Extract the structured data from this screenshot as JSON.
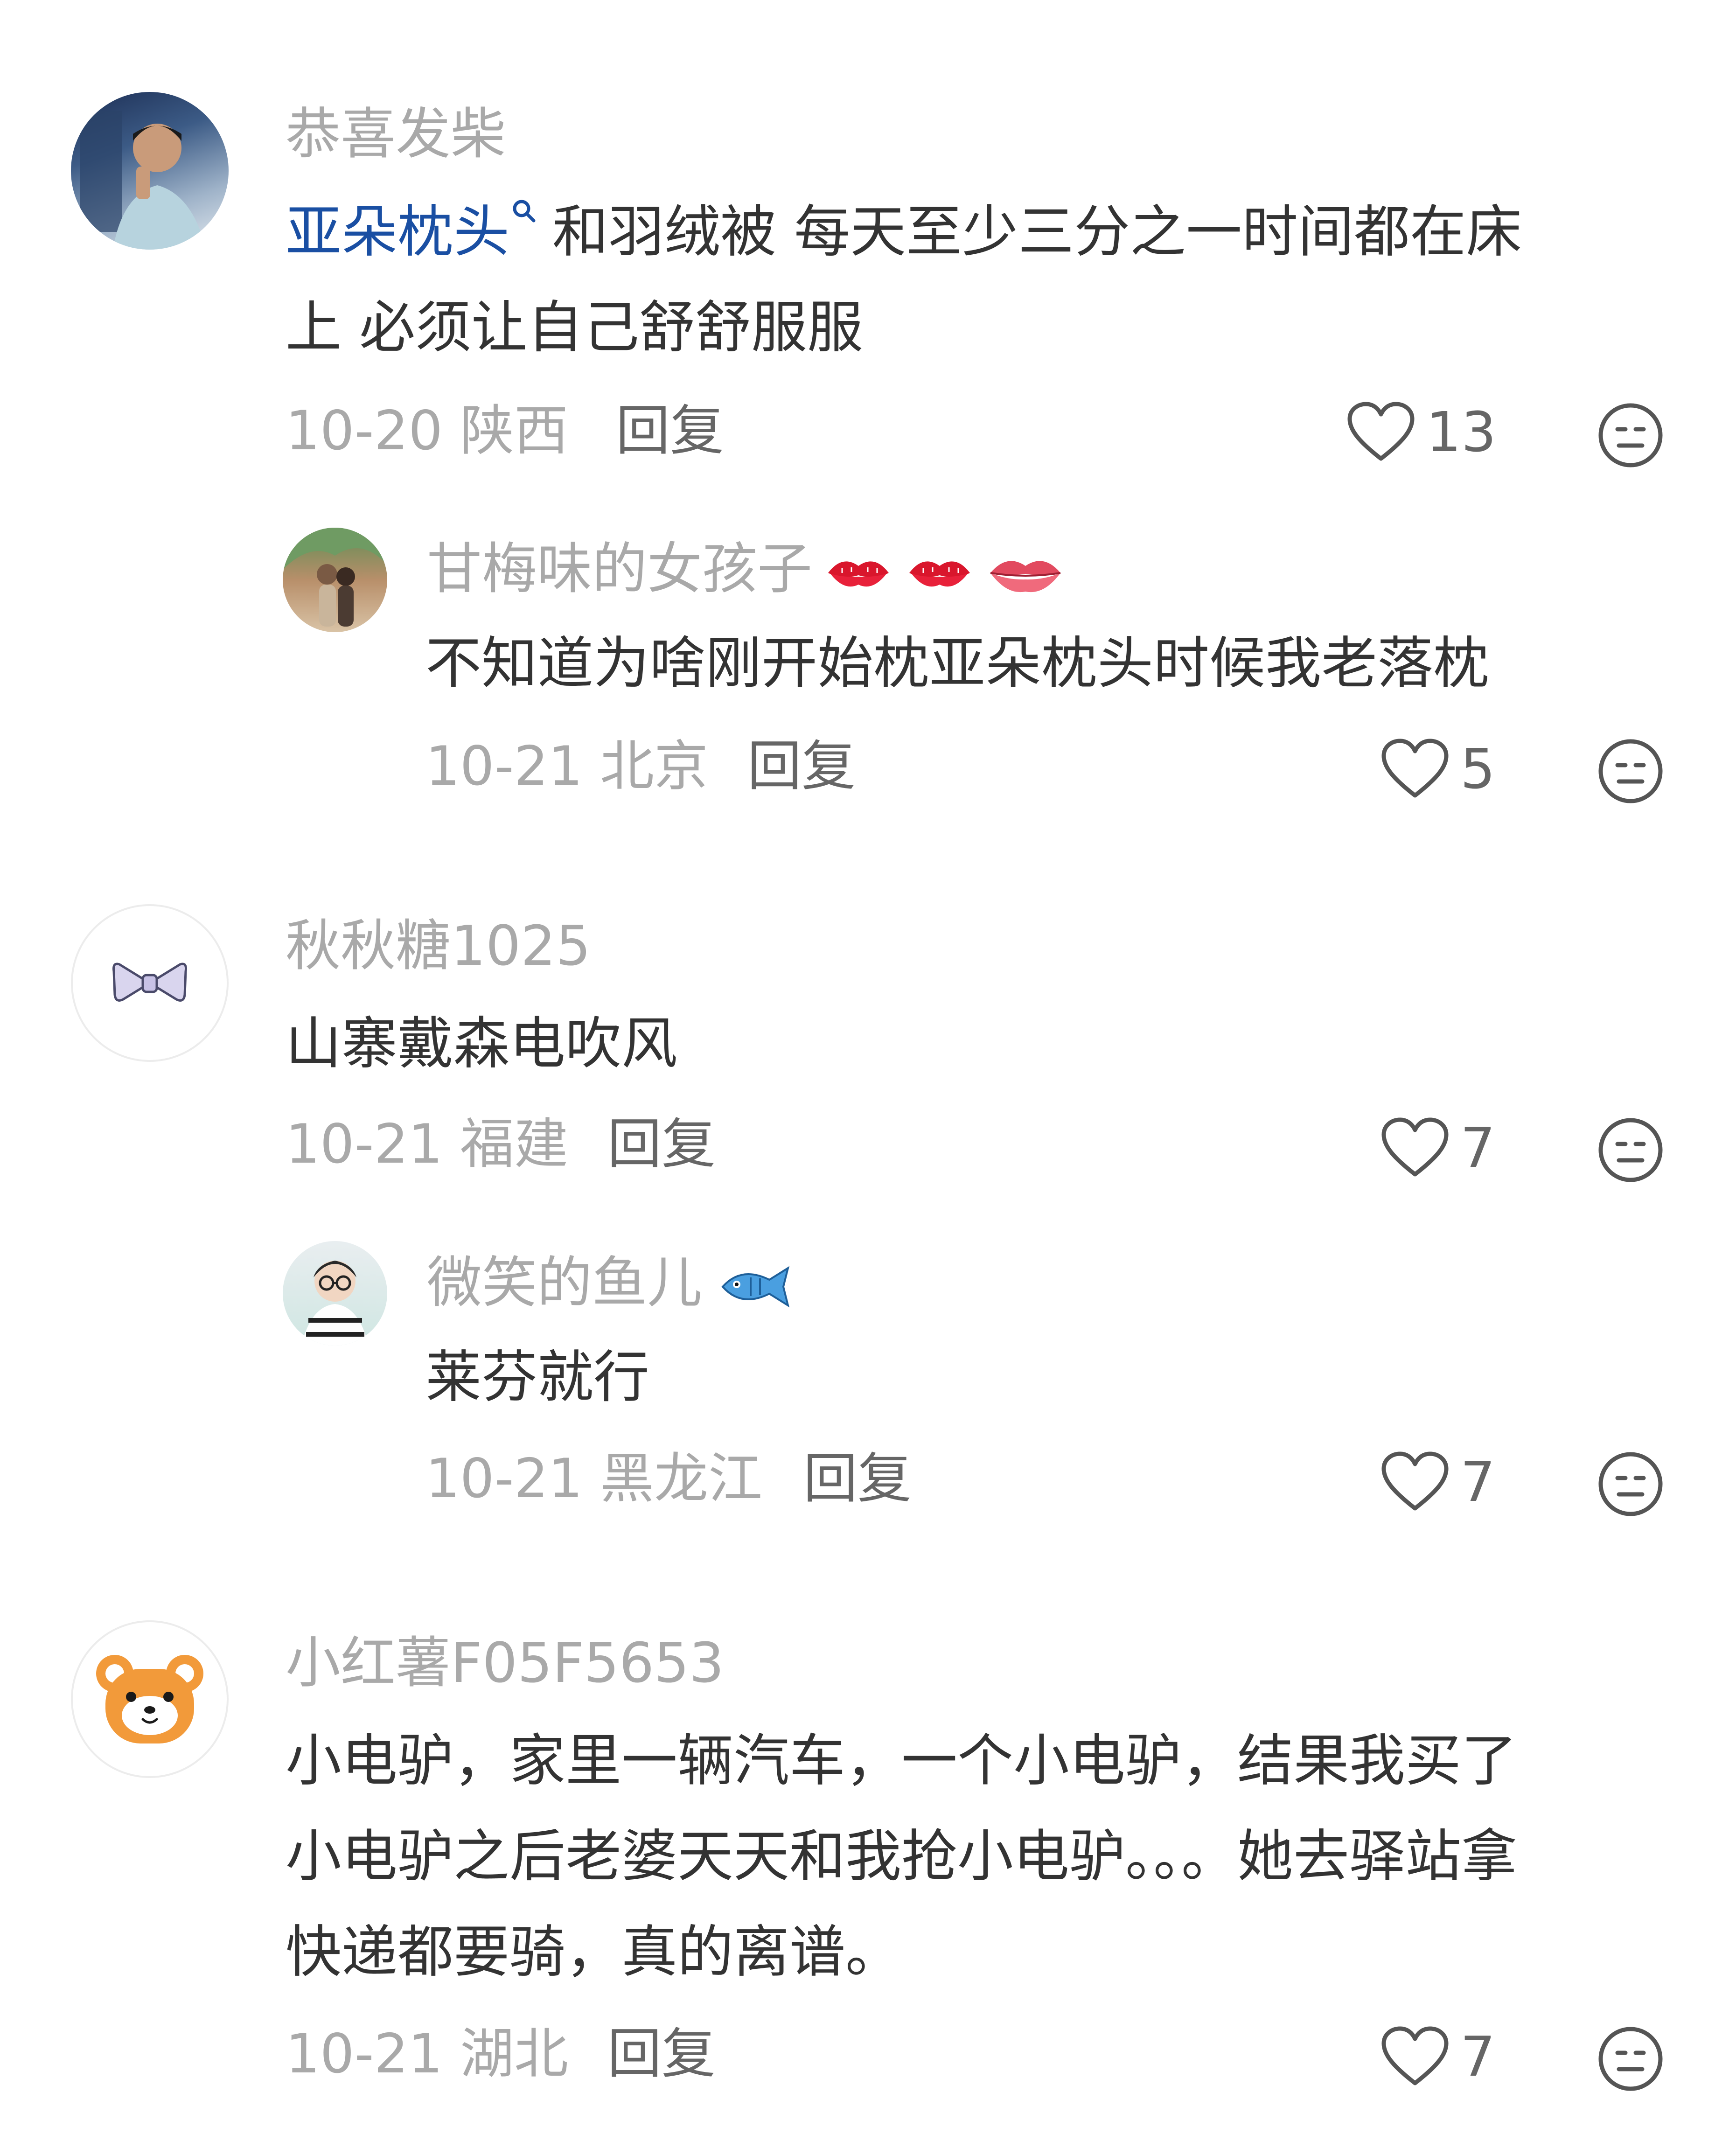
{
  "colors": {
    "username": "#a9a9a9",
    "text": "#333333",
    "mention": "#1a4fa3",
    "meta": "#a9a9a9",
    "reply": "#666666",
    "icon": "#555555"
  },
  "comments": [
    {
      "username": "恭喜发柴",
      "avatar": "man-photo-avatar",
      "mention": "亚朵枕头",
      "mention_icon": "search-icon",
      "text_line1": "和羽绒被 每天至少三分之一时间都在床",
      "text_line2": "上 必须让自己舒舒服服",
      "date_location": "10-20 陕西",
      "reply_label": "回复",
      "likes": "13",
      "react_icon": "emoji-face-icon"
    },
    {
      "username": "甘梅味的女孩子",
      "avatar": "couple-photo-avatar",
      "badge_icons": [
        "kiss-mark-icon",
        "kiss-mark-icon",
        "lips-icon"
      ],
      "text_line1": "不知道为啥刚开始枕亚朵枕头时候我老落枕",
      "date_location": "10-21 北京",
      "reply_label": "回复",
      "likes": "5",
      "react_icon": "emoji-face-icon"
    },
    {
      "username": "秋秋糖1025",
      "avatar": "bow-avatar",
      "text_line1": "山寨戴森电吹风",
      "date_location": "10-21 福建",
      "reply_label": "回复",
      "likes": "7",
      "react_icon": "emoji-face-icon"
    },
    {
      "username": "微笑的鱼儿",
      "avatar": "boy-glasses-avatar",
      "badge_icons": [
        "fish-icon"
      ],
      "text_line1": "莱芬就行",
      "date_location": "10-21 黑龙江",
      "reply_label": "回复",
      "likes": "7",
      "react_icon": "emoji-face-icon"
    },
    {
      "username": "小红薯F05F5653",
      "avatar": "bear-avatar",
      "text_line1": "小电驴，家里一辆汽车，一个小电驴，结果我买了",
      "text_line2": "小电驴之后老婆天天和我抢小电驴。。。她去驿站拿",
      "text_line3": "快递都要骑，真的离谱。",
      "date_location": "10-21 湖北",
      "reply_label": "回复",
      "likes": "7",
      "react_icon": "emoji-face-icon"
    }
  ]
}
